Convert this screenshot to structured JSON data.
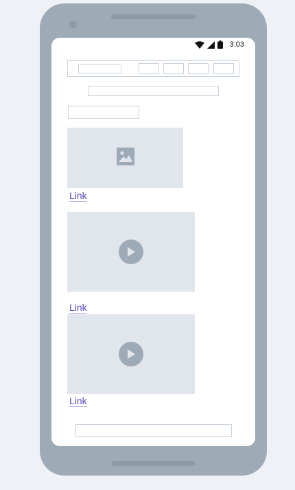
{
  "status_bar": {
    "time": "3:03"
  },
  "links": [
    {
      "label": "Link"
    },
    {
      "label": "Link"
    },
    {
      "label": "Link"
    }
  ],
  "colors": {
    "frame": "#9eaab6",
    "placeholder_fill": "#e1e6ec",
    "placeholder_border": "#c9d2dc",
    "link": "#5b48c4"
  },
  "icons": [
    "wifi-icon",
    "signal-icon",
    "battery-icon",
    "image-icon",
    "play-icon"
  ]
}
